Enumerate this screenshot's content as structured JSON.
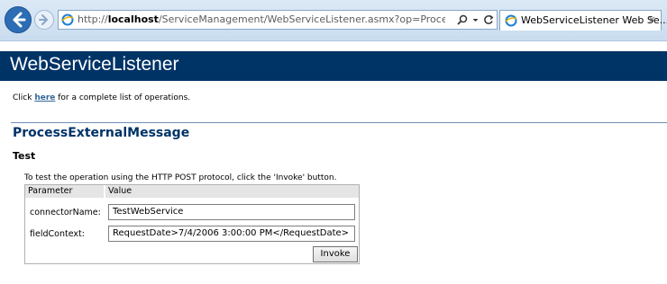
{
  "browser": {
    "url_prefix": "http://",
    "url_host": "localhost",
    "url_rest": "/ServiceManagement/WebServiceListener.asmx?op=ProcessExternalMes:",
    "search_icon": "search-icon",
    "refresh_icon": "refresh-icon",
    "tab_title": "WebServiceListener Web Se...",
    "tab_close": "×"
  },
  "page": {
    "banner_title": "WebServiceListener",
    "intro_prefix": "Click ",
    "intro_link": "here",
    "intro_suffix": " for a complete list of operations.",
    "operation_title": "ProcessExternalMessage",
    "section_title": "Test",
    "instructions": "To test the operation using the HTTP POST protocol, click the 'Invoke' button."
  },
  "form": {
    "headers": [
      "Parameter",
      "Value"
    ],
    "rows": [
      {
        "label": "connectorName:",
        "value": "TestWebService"
      },
      {
        "label": "fieldContext:",
        "value": "RequestDate>7/4/2006 3:00:00 PM</RequestDate>"
      }
    ],
    "invoke_label": "Invoke"
  },
  "colors": {
    "banner": "#003366",
    "heading": "#003366",
    "link": "#336699"
  }
}
